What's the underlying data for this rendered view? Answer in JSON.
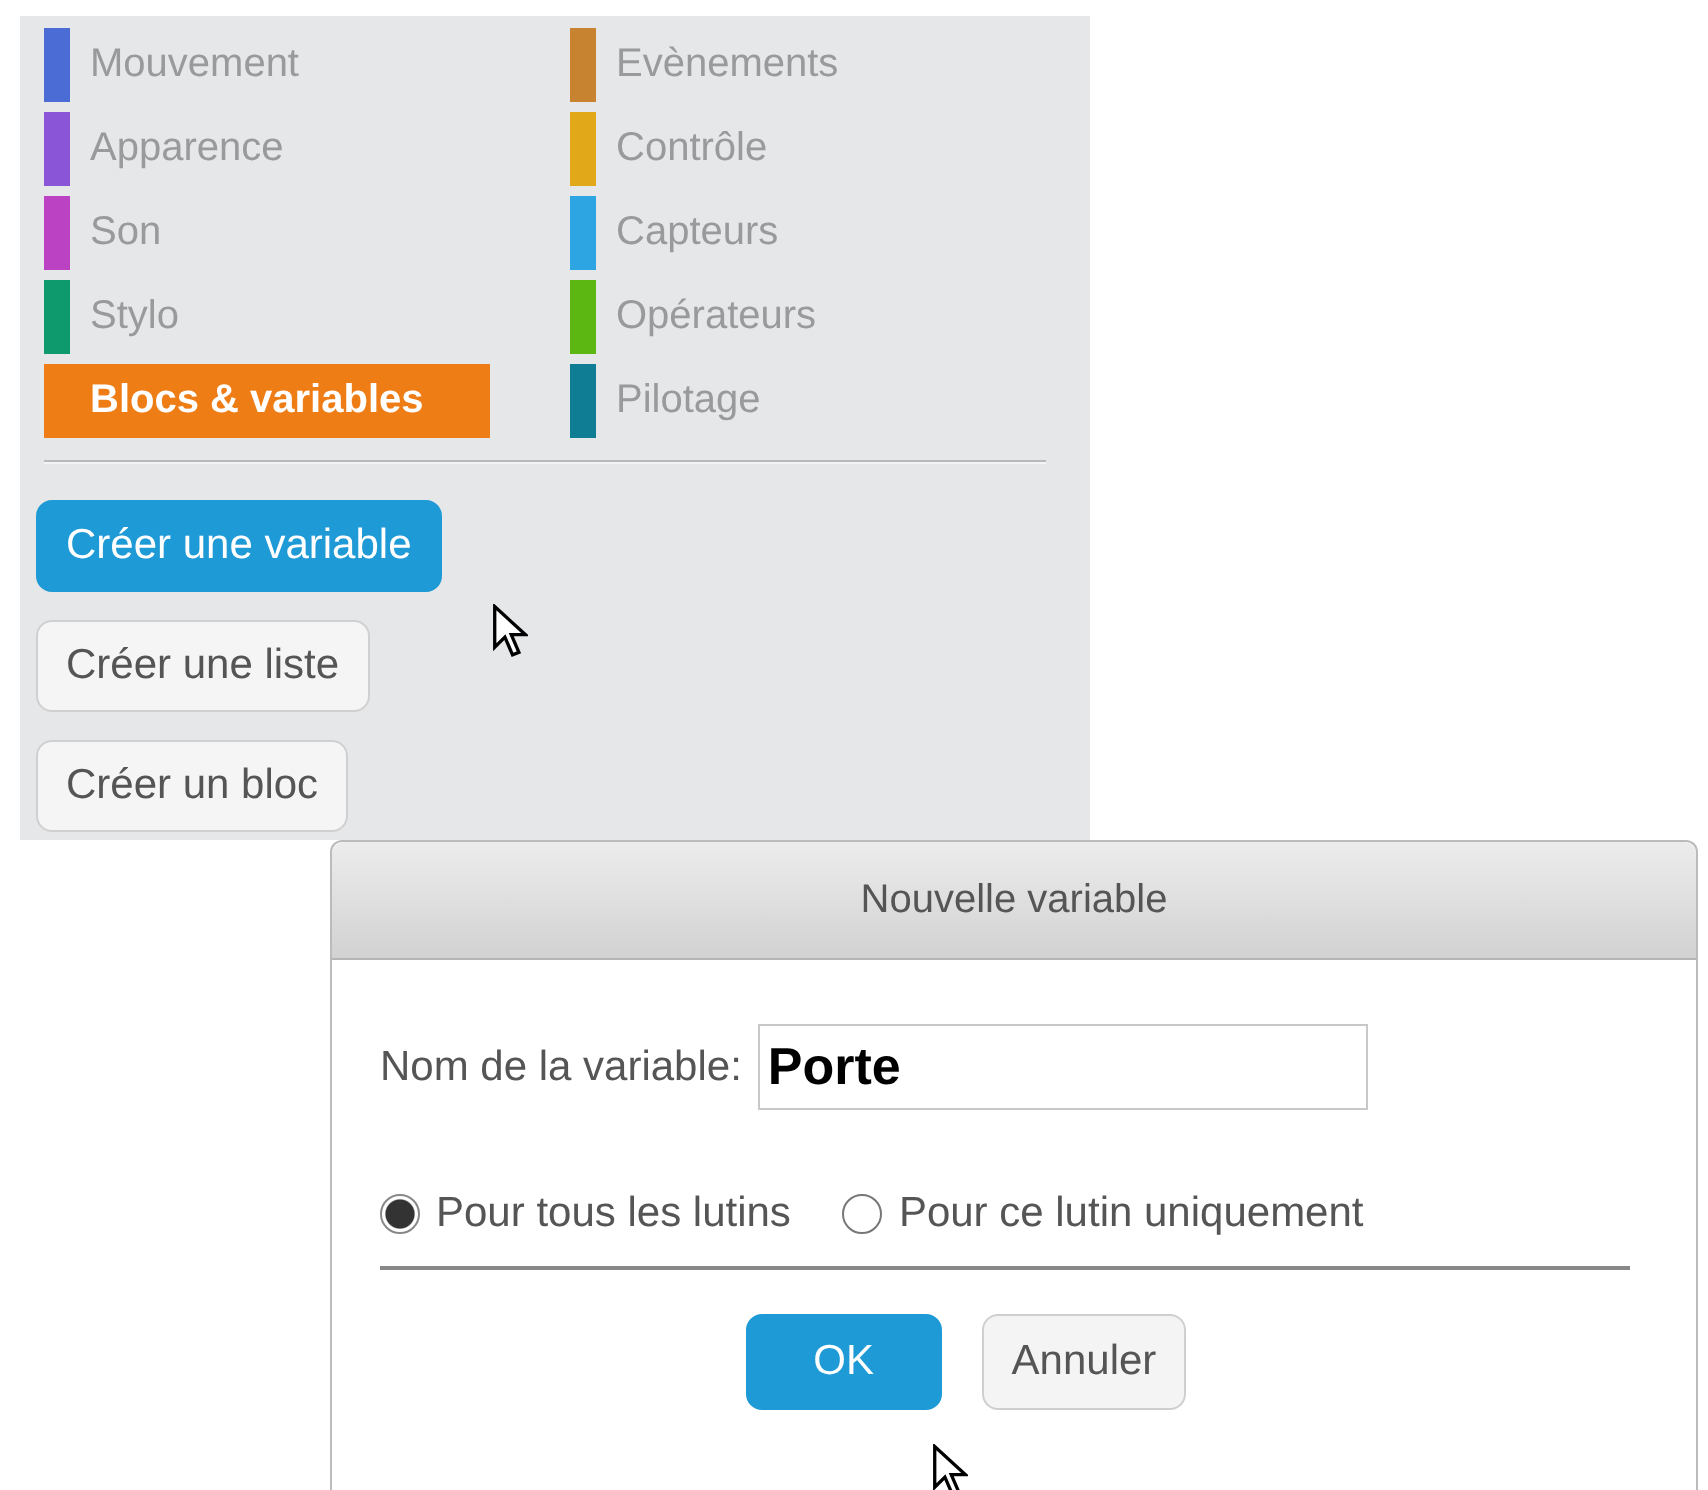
{
  "palette": {
    "categories": [
      {
        "label": "Mouvement",
        "color": "#4a6cd4",
        "selected": false
      },
      {
        "label": "Apparence",
        "color": "#8a55d7",
        "selected": false
      },
      {
        "label": "Son",
        "color": "#bb42c3",
        "selected": false
      },
      {
        "label": "Stylo",
        "color": "#0e9a6c",
        "selected": false
      },
      {
        "label": "Blocs & variables",
        "color": "#ee7d16",
        "selected": true
      },
      {
        "label": "Evènements",
        "color": "#c88330",
        "selected": false
      },
      {
        "label": "Contrôle",
        "color": "#e1a91a",
        "selected": false
      },
      {
        "label": "Capteurs",
        "color": "#2ca5e2",
        "selected": false
      },
      {
        "label": "Opérateurs",
        "color": "#5cb712",
        "selected": false
      },
      {
        "label": "Pilotage",
        "color": "#0f7e94",
        "selected": false
      }
    ],
    "buttons": [
      {
        "label": "Créer une variable",
        "highlighted": true
      },
      {
        "label": "Créer une liste",
        "highlighted": false
      },
      {
        "label": "Créer un bloc",
        "highlighted": false
      }
    ]
  },
  "dialog": {
    "title": "Nouvelle variable",
    "field": {
      "label": "Nom de la variable:",
      "value": "Porte"
    },
    "scope": [
      {
        "label": "Pour tous les lutins",
        "selected": true
      },
      {
        "label": "Pour ce lutin uniquement",
        "selected": false
      }
    ],
    "buttons": [
      {
        "label": "OK",
        "highlighted": true
      },
      {
        "label": "Annuler",
        "highlighted": false
      }
    ]
  }
}
